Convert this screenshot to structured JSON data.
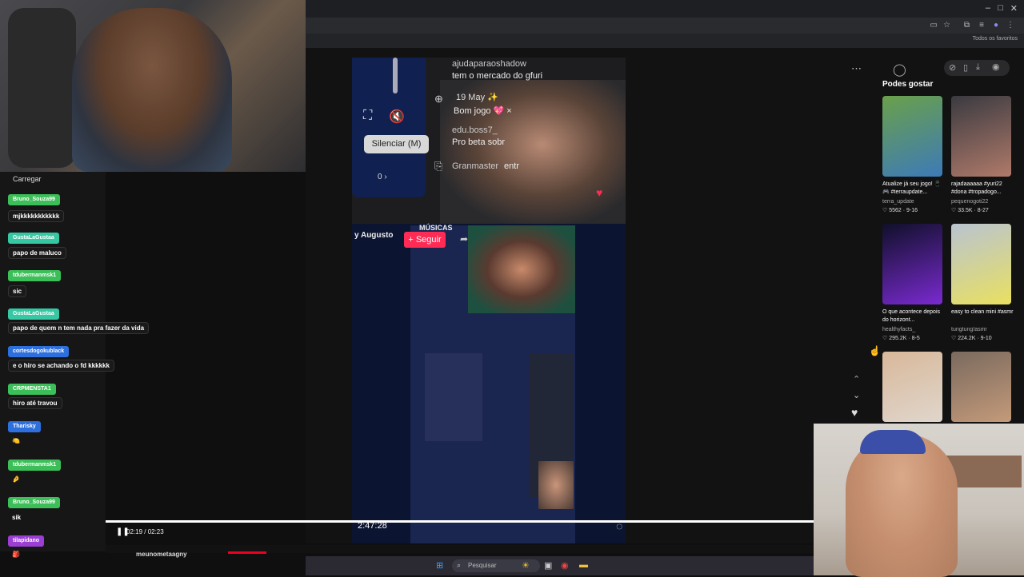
{
  "browser": {
    "window_controls": [
      "–",
      "□",
      "✕"
    ],
    "bookmarks_label": "Todos os favoritos"
  },
  "chat": {
    "load_label": "Carregar",
    "messages": [
      {
        "user": "Bruno_Souza99",
        "user_color": "#3cbf58",
        "text": "mjkkkkkkkkkkk"
      },
      {
        "user": "GustaLaGustaa",
        "user_color": "#36c7a3",
        "text": "papo de maluco"
      },
      {
        "user": "tdubermanmsk1",
        "user_color": "#3cbf58",
        "text": "sic"
      },
      {
        "user": "GustaLaGustaa",
        "user_color": "#36c7a3",
        "text": "papo de quem n tem nada pra fazer da vida"
      },
      {
        "user": "cortesdogokublack",
        "user_color": "#2d6fdc",
        "text": "e o hiro se achando o fd kkkkkk"
      },
      {
        "user": "CRPMENSTA1",
        "user_color": "#3cbf58",
        "text": "hiro até travou"
      },
      {
        "user": "Tharisky",
        "user_color": "#2d6fdc",
        "text": "🍋"
      },
      {
        "user": "tdubermanmsk1",
        "user_color": "#3cbf58",
        "text": "🤌"
      },
      {
        "user": "Bruno_Souza99",
        "user_color": "#3cbf58",
        "text": "sik"
      },
      {
        "user": "tilapidano",
        "user_color": "#9b3fd4",
        "text": "🎒"
      }
    ]
  },
  "player": {
    "tooltip": "Silenciar (M)",
    "live_count": "0 ›",
    "comments": [
      {
        "user": "ajudaparaoshadow",
        "text": "tem o mercado do gfuri"
      },
      {
        "user": "19 May ✨",
        "text": "Bom jogo 💖 ×"
      },
      {
        "user": "edu.boss7_",
        "text": "Pro beta sobr"
      },
      {
        "user": "Granmaster",
        "text": "entr"
      }
    ],
    "author": "y Augusto",
    "follow_label": "+ Seguir",
    "music_label": "MÚSICAS",
    "elapsed_overlay": "2:47:28",
    "time": "02:19 / 02:23",
    "progress": 0.97,
    "author_bottom": "meunometaagny"
  },
  "sidebar": {
    "title": "Podes gostar",
    "items": [
      {
        "caption": "Atualize já seu jogo! 📱🎮 #terraupdate...",
        "author": "terra_update",
        "stats": "♡ 5562 · 9-16",
        "colors": [
          "#6aa04a",
          "#3d7ab8"
        ]
      },
      {
        "caption": "rajadaaaaaa #yuri22 #dona #tropadogo...",
        "author": "pequenogoti22",
        "stats": "♡ 33.5K · 8-27",
        "colors": [
          "#3a3a40",
          "#b07a6a"
        ]
      },
      {
        "caption": "O que acontece depois do horizont...",
        "author": "healthyfacts_",
        "stats": "♡ 295.2K · 8-5",
        "colors": [
          "#10102a",
          "#7a2ad0"
        ]
      },
      {
        "caption": "easy to clean mini #asmr",
        "author": "tungtung!asmr",
        "stats": "♡ 224.2K · 9-10",
        "colors": [
          "#b9c4d0",
          "#e9e060"
        ]
      },
      {
        "caption": "",
        "author": "",
        "stats": "",
        "colors": [
          "#d8b89a",
          "#e0d6cc"
        ]
      },
      {
        "caption": "",
        "author": "",
        "stats": "",
        "colors": [
          "#7a6a5e",
          "#c49a7a"
        ]
      }
    ]
  },
  "taskbar": {
    "search_placeholder": "Pesquisar"
  },
  "accent": "#fe2c55"
}
